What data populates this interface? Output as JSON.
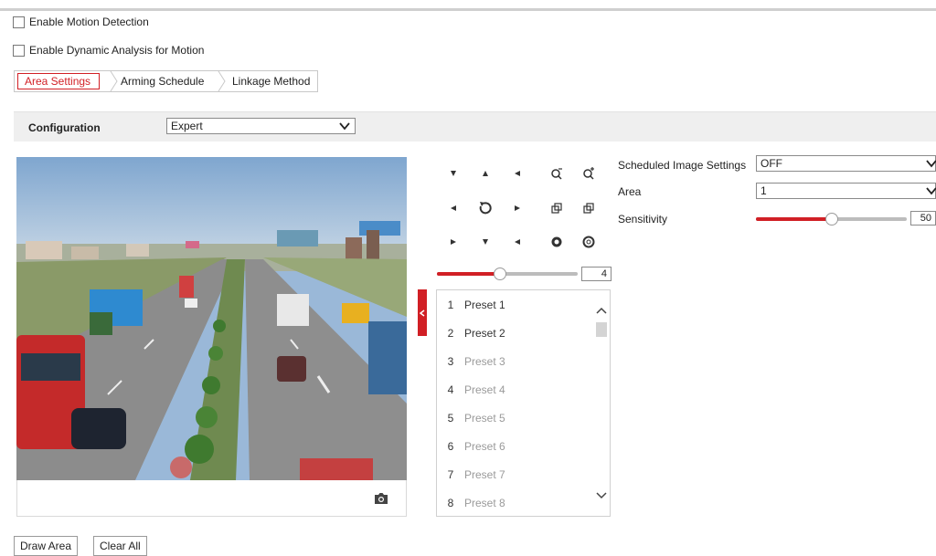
{
  "checkboxes": {
    "motion_detection": "Enable Motion Detection",
    "dynamic_analysis": "Enable Dynamic Analysis for Motion"
  },
  "tabs": [
    {
      "label": "Area Settings",
      "active": true
    },
    {
      "label": "Arming Schedule",
      "active": false
    },
    {
      "label": "Linkage Method",
      "active": false
    }
  ],
  "configuration": {
    "label": "Configuration",
    "value": "Expert"
  },
  "ptz": {
    "zoom_value": "4",
    "zoom_fraction": 0.45
  },
  "presets": [
    {
      "num": "1",
      "name": "Preset 1",
      "configured": true
    },
    {
      "num": "2",
      "name": "Preset 2",
      "configured": true
    },
    {
      "num": "3",
      "name": "Preset 3",
      "configured": false
    },
    {
      "num": "4",
      "name": "Preset 4",
      "configured": false
    },
    {
      "num": "5",
      "name": "Preset 5",
      "configured": false
    },
    {
      "num": "6",
      "name": "Preset 6",
      "configured": false
    },
    {
      "num": "7",
      "name": "Preset 7",
      "configured": false
    },
    {
      "num": "8",
      "name": "Preset 8",
      "configured": false
    }
  ],
  "settings": {
    "scheduled_label": "Scheduled Image Settings",
    "scheduled_value": "OFF",
    "area_label": "Area",
    "area_value": "1",
    "sensitivity_label": "Sensitivity",
    "sensitivity_value": "50",
    "sensitivity_fraction": 0.5
  },
  "buttons": {
    "draw_area": "Draw Area",
    "clear_all": "Clear All"
  },
  "colors": {
    "accent": "#d11f25",
    "config_bar": "#efefef"
  }
}
